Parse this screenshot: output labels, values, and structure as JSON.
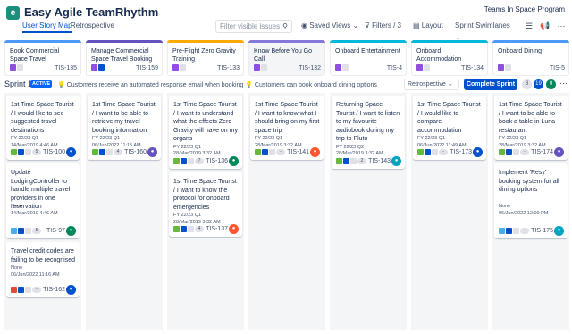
{
  "app": {
    "logo": "e",
    "title": "Easy Agile TeamRhythm",
    "program": "Teams In Space Program"
  },
  "tabs": [
    {
      "label": "User Story Map"
    },
    {
      "label": "Retrospective"
    }
  ],
  "toolbar": {
    "search_placeholder": "Filter visible issues",
    "search_icon": "magnifier-icon",
    "saved_views": "Saved Views",
    "filters": "Filters / 3",
    "layout": "Layout",
    "swimlanes": "Sprint Swimlanes",
    "icon_buttons": [
      "stack-icon",
      "megaphone-icon",
      "more-icon"
    ]
  },
  "colors": {
    "accent": "#0052cc",
    "active": "#0065ff",
    "done": "#00875a",
    "story": "#63ba3c",
    "task": "#4bade8",
    "bug": "#e5493a",
    "epic": "#904ee2"
  },
  "epics": [
    {
      "title": "Book Commercial Space Travel",
      "key": "TIS-135",
      "color": "#4c9aff"
    },
    {
      "title": "Manage Commercial Space Travel Booking",
      "key": "TIS-159",
      "color": "#6554c0"
    },
    {
      "title": "Pre-Flight Zero Gravity Training",
      "key": "TIS-133",
      "color": "#ffab00"
    },
    {
      "title": "Know Before You Go Call",
      "key": "TIS-132",
      "color": "#8777d9"
    },
    {
      "title": "Onboard Entertainment",
      "key": "TIS-4",
      "color": "#00b8d9"
    },
    {
      "title": "Onboard Accommodation",
      "key": "TIS-134",
      "color": "#00b8d9"
    },
    {
      "title": "Onboard Dining",
      "key": "TIS-5",
      "color": "#4c9aff"
    }
  ],
  "sprint": {
    "name": "Sprint 1",
    "status": "ACTIVE",
    "goal": "💡 Customers receive an automated response email when booking 💡 Customers can book onboard dining options",
    "retro_label": "Retrospective",
    "complete_label": "Complete Sprint",
    "counts": [
      "8",
      "19",
      "0"
    ],
    "more": "⋯"
  },
  "cards": [
    {
      "title": "1st Time Space Tourist / I would like to see suggested travel destinations",
      "meta1": "FY 22/23 Q1",
      "meta2": "14/Mar/2019 4:46 AM",
      "key": "TIS-100",
      "count": "5",
      "type": "story"
    },
    {
      "title": "1st Time Space Tourist / I want to be able to retrieve my travel booking information",
      "meta1": "FY 22/23 Q1",
      "meta2": "06/Jun/2022 11:15 AM",
      "key": "TIS-160",
      "count": "4",
      "type": "story"
    },
    {
      "title": "1st Time Space Tourist / I want to understand what the effects Zero Gravity will have on my organs",
      "meta1": "FY 22/23 Q1",
      "meta2": "28/Mar/2019 3:32 AM",
      "key": "TIS-136",
      "count": "7",
      "type": "story"
    },
    {
      "title": "1st Time Space Tourist / I want to know what I should bring on my first space trip",
      "meta1": "FY 22/23 Q1",
      "meta2": "28/Mar/2019 3:32 AM",
      "key": "TIS-141",
      "count": "",
      "type": "story"
    },
    {
      "title": "Returning Space Tourist / I want to listen to my favourite audiobook during my trip to Pluto",
      "meta1": "FY 22/23 Q2",
      "meta2": "28/Mar/2019 3:32 AM",
      "key": "TIS-143",
      "count": "2",
      "type": "story"
    },
    {
      "title": "1st Time Space Tourist / I would like to compare accommodation",
      "meta1": "FY 22/23 Q1",
      "meta2": "06/Jun/2022 11:49 AM",
      "key": "TIS-173",
      "count": "",
      "type": "story"
    },
    {
      "title": "1st Time Space Tourist / I want to be able to book a table in Luna restaurant",
      "meta1": "FY 22/23 Q1",
      "meta2": "28/Mar/2019 3:32 AM",
      "key": "TIS-174",
      "count": "",
      "type": "story"
    },
    {
      "title": "Update LodgingController to handle multiple travel providers in one reservation",
      "meta1": "None",
      "meta2": "14/Mar/2019 4:46 AM",
      "key": "TIS-97",
      "count": "5",
      "type": "task"
    },
    {
      "title": "1st Time Space Tourist / I want to know the protocol for onboard emergencies",
      "meta1": "FY 22/23 Q1",
      "meta2": "28/Mar/2019 3:32 AM",
      "key": "TIS-137",
      "count": "4",
      "type": "story"
    },
    {
      "title": "Implement 'Resy' booking system for all dining options",
      "meta1": "None",
      "meta2": "06/Jun/2022 12:00 PM",
      "key": "TIS-175",
      "count": "",
      "type": "task"
    },
    {
      "title": "Travel credit codes are failing to be recognised",
      "meta1": "None",
      "meta2": "06/Jun/2022 11:16 AM",
      "key": "TIS-162",
      "count": "",
      "type": "bug"
    }
  ]
}
